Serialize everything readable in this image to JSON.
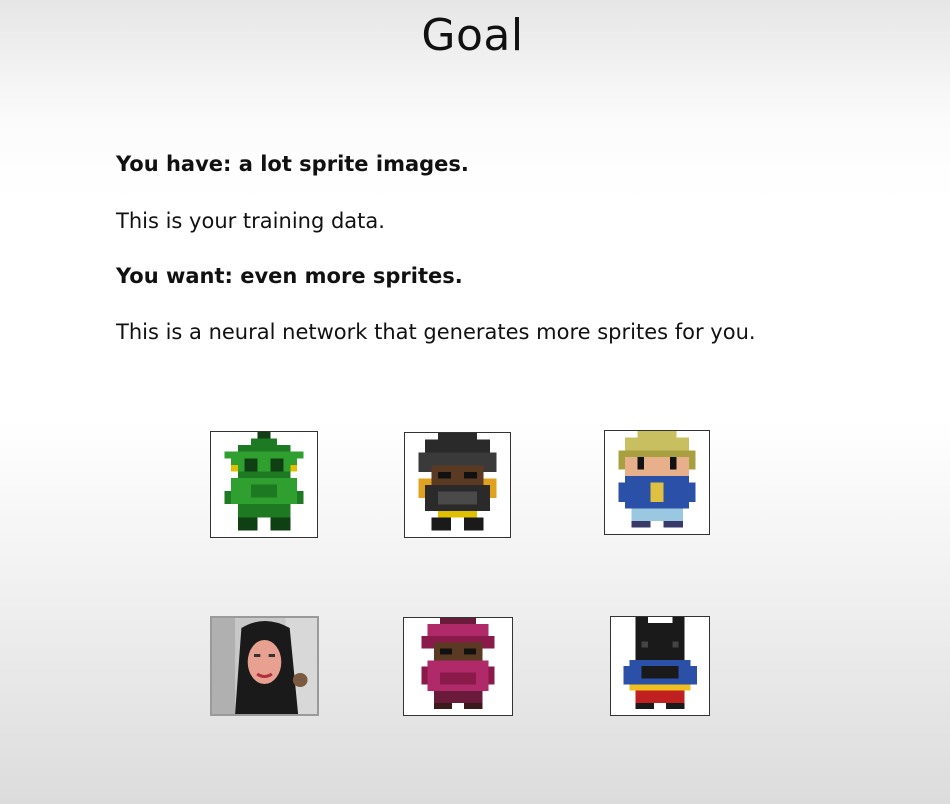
{
  "slide": {
    "title": "Goal",
    "lines": [
      {
        "text": "You have: a lot sprite images.",
        "bold": true
      },
      {
        "text": "This is your training data.",
        "bold": false
      },
      {
        "text": "You want: even more sprites.",
        "bold": true
      },
      {
        "text": "This is a neural network that generates more sprites for you.",
        "bold": false
      }
    ]
  },
  "sprites": [
    {
      "subject": "green goblin character",
      "palette": [
        "#1e7a22",
        "#2fa02f",
        "#0f3f12",
        "#e0c000"
      ]
    },
    {
      "subject": "dark hooded character",
      "palette": [
        "#2a2a2a",
        "#4a4a4a",
        "#5a3a22",
        "#e0a020"
      ]
    },
    {
      "subject": "blonde character in blue",
      "palette": [
        "#c8c060",
        "#e8b08a",
        "#2a50a8",
        "#9ac8e0"
      ]
    },
    {
      "subject": "photo of a woman",
      "palette": [
        "#1a1a1a",
        "#e8a090",
        "#c0c0c0"
      ]
    },
    {
      "subject": "magenta hooded character",
      "palette": [
        "#8a1a4a",
        "#b02a6a",
        "#4a2a1a",
        "#6a1a3a"
      ]
    },
    {
      "subject": "black cat-eared character",
      "palette": [
        "#1a1a1a",
        "#2a50a8",
        "#c02020",
        "#f0c020"
      ]
    }
  ]
}
